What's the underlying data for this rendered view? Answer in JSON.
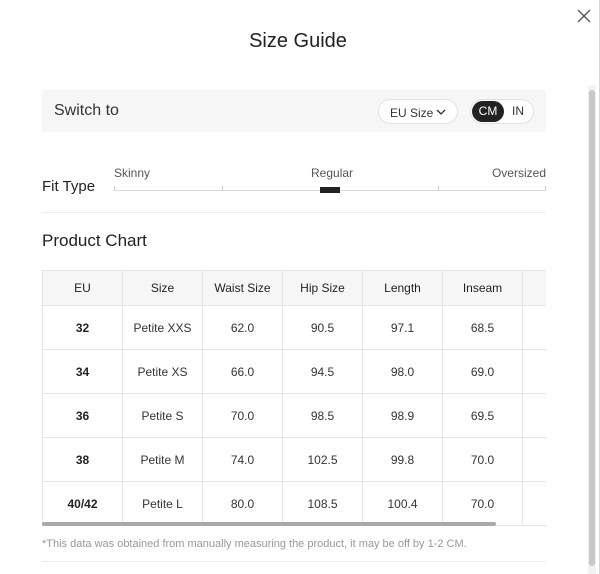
{
  "title": "Size Guide",
  "switch": {
    "label": "Switch to",
    "size_system": "EU Size",
    "units": [
      "CM",
      "IN"
    ],
    "active_unit": "CM"
  },
  "fit": {
    "label": "Fit Type",
    "options": [
      "Skinny",
      "Regular",
      "Oversized"
    ],
    "selected": "Regular"
  },
  "chart": {
    "title": "Product Chart",
    "columns": [
      "EU",
      "Size",
      "Waist Size",
      "Hip Size",
      "Length",
      "Inseam",
      ""
    ],
    "rows": [
      [
        "32",
        "Petite XXS",
        "62.0",
        "90.5",
        "97.1",
        "68.5",
        ""
      ],
      [
        "34",
        "Petite XS",
        "66.0",
        "94.5",
        "98.0",
        "69.0",
        ""
      ],
      [
        "36",
        "Petite S",
        "70.0",
        "98.5",
        "98.9",
        "69.5",
        ""
      ],
      [
        "38",
        "Petite M",
        "74.0",
        "102.5",
        "99.8",
        "70.0",
        ""
      ],
      [
        "40/42",
        "Petite L",
        "80.0",
        "108.5",
        "100.4",
        "70.0",
        ""
      ]
    ]
  },
  "note": "*This data was obtained from manually measuring the product, it may be off by 1-2 CM."
}
